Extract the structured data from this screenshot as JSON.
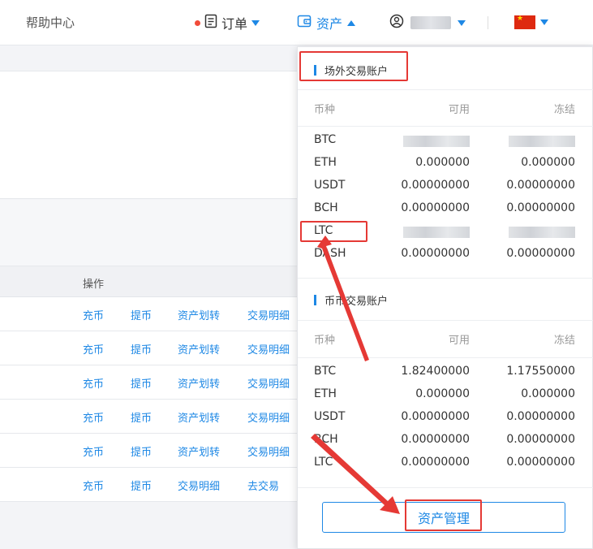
{
  "header": {
    "help_center": "帮助中心",
    "orders_label": "订单",
    "assets_label": "资产",
    "username_masked": "",
    "accent_color": "#1e88e5",
    "dot_color": "#f14b3a"
  },
  "page": {
    "table_ops_header": "操作",
    "rows": [
      {
        "a1": "充币",
        "a2": "提币",
        "a3": "资产划转",
        "a4": "交易明细"
      },
      {
        "a1": "充币",
        "a2": "提币",
        "a3": "资产划转",
        "a4": "交易明细"
      },
      {
        "a1": "充币",
        "a2": "提币",
        "a3": "资产划转",
        "a4": "交易明细"
      },
      {
        "a1": "充币",
        "a2": "提币",
        "a3": "资产划转",
        "a4": "交易明细"
      },
      {
        "a1": "充币",
        "a2": "提币",
        "a3": "资产划转",
        "a4": "交易明细"
      },
      {
        "a1": "充币",
        "a2": "提币",
        "a3": "交易明细",
        "a4": "去交易"
      }
    ]
  },
  "dropdown": {
    "otc": {
      "title": "场外交易账户",
      "headers": {
        "coin": "币种",
        "available": "可用",
        "frozen": "冻结"
      },
      "rows": [
        {
          "coin": "BTC",
          "available": "",
          "frozen": ""
        },
        {
          "coin": "ETH",
          "available": "0.000000",
          "frozen": "0.000000"
        },
        {
          "coin": "USDT",
          "available": "0.00000000",
          "frozen": "0.00000000"
        },
        {
          "coin": "BCH",
          "available": "0.00000000",
          "frozen": "0.00000000"
        },
        {
          "coin": "LTC",
          "available": "",
          "frozen": ""
        },
        {
          "coin": "DASH",
          "available": "0.00000000",
          "frozen": "0.00000000"
        }
      ]
    },
    "spot": {
      "title": "币币交易账户",
      "headers": {
        "coin": "币种",
        "available": "可用",
        "frozen": "冻结"
      },
      "rows": [
        {
          "coin": "BTC",
          "available": "1.82400000",
          "frozen": "1.17550000"
        },
        {
          "coin": "ETH",
          "available": "0.000000",
          "frozen": "0.000000"
        },
        {
          "coin": "USDT",
          "available": "0.00000000",
          "frozen": "0.00000000"
        },
        {
          "coin": "BCH",
          "available": "0.00000000",
          "frozen": "0.00000000"
        },
        {
          "coin": "LTC",
          "available": "0.00000000",
          "frozen": "0.00000000"
        }
      ]
    },
    "manage_button": "资产管理"
  }
}
